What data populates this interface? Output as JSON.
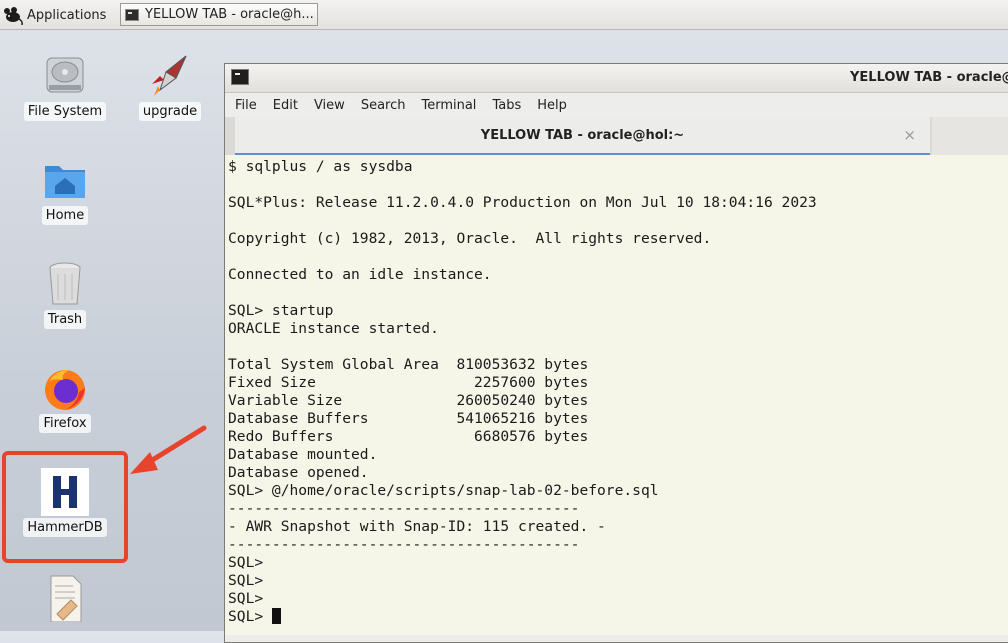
{
  "panel": {
    "applications_label": "Applications",
    "taskbar_label": "YELLOW TAB - oracle@h..."
  },
  "desktop": {
    "icons": [
      {
        "label": "File System",
        "icon": "drive-icon"
      },
      {
        "label": "upgrade",
        "icon": "rocket-icon"
      },
      {
        "label": "Home",
        "icon": "home-folder-icon"
      },
      {
        "label": "Trash",
        "icon": "trash-icon"
      },
      {
        "label": "Firefox",
        "icon": "firefox-icon"
      },
      {
        "label": "HammerDB",
        "icon": "hammerdb-icon"
      },
      {
        "label": "",
        "icon": "document-icon"
      }
    ]
  },
  "terminal": {
    "window_title": "YELLOW TAB - oracle@hol:~",
    "menu": [
      "File",
      "Edit",
      "View",
      "Search",
      "Terminal",
      "Tabs",
      "Help"
    ],
    "tab_title": "YELLOW TAB - oracle@hol:~",
    "tab_close": "×",
    "lines": [
      "$ sqlplus / as sysdba",
      "",
      "SQL*Plus: Release 11.2.0.4.0 Production on Mon Jul 10 18:04:16 2023",
      "",
      "Copyright (c) 1982, 2013, Oracle.  All rights reserved.",
      "",
      "Connected to an idle instance.",
      "",
      "SQL> startup",
      "ORACLE instance started.",
      "",
      "Total System Global Area  810053632 bytes",
      "Fixed Size                  2257600 bytes",
      "Variable Size             260050240 bytes",
      "Database Buffers          541065216 bytes",
      "Redo Buffers                6680576 bytes",
      "Database mounted.",
      "Database opened.",
      "SQL> @/home/oracle/scripts/snap-lab-02-before.sql",
      "----------------------------------------",
      "- AWR Snapshot with Snap-ID: 115 created. -",
      "----------------------------------------",
      "SQL>",
      "SQL>",
      "SQL>",
      "SQL> "
    ]
  },
  "colors": {
    "terminal_bg": "#f5f5e8",
    "annotation_red": "#e8432d",
    "tab_underline": "#5c8fd6"
  }
}
